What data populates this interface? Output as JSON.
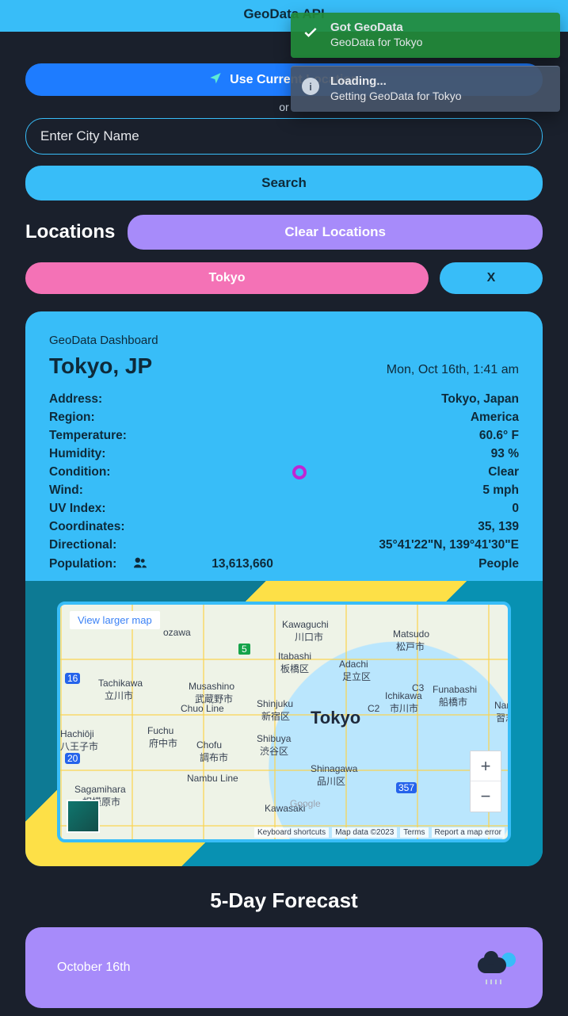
{
  "header": {
    "title": "GeoData API"
  },
  "controls": {
    "use_location_label": "Use Current Location",
    "or_label": "or",
    "city_placeholder": "Enter City Name",
    "search_label": "Search"
  },
  "locations": {
    "heading": "Locations",
    "clear_label": "Clear Locations",
    "items": [
      {
        "name": "Tokyo",
        "remove_label": "X"
      }
    ]
  },
  "toasts": [
    {
      "kind": "success",
      "title": "Got GeoData",
      "body": "GeoData for Tokyo"
    },
    {
      "kind": "info",
      "title": "Loading...",
      "body": "Getting GeoData for Tokyo"
    }
  ],
  "dashboard": {
    "label": "GeoData Dashboard",
    "city": "Tokyo, JP",
    "datetime": "Mon, Oct 16th, 1:41 am",
    "rows": {
      "address": {
        "k": "Address:",
        "v": "Tokyo, Japan"
      },
      "region": {
        "k": "Region:",
        "v": "America"
      },
      "temp": {
        "k": "Temperature:",
        "v": "60.6° F"
      },
      "humidity": {
        "k": "Humidity:",
        "v": "93 %"
      },
      "condition": {
        "k": "Condition:",
        "v": "Clear"
      },
      "wind": {
        "k": "Wind:",
        "v": "5 mph"
      },
      "uv": {
        "k": "UV Index:",
        "v": "0"
      },
      "coords": {
        "k": "Coordinates:",
        "v": "35, 139"
      },
      "direction": {
        "k": "Directional:",
        "v": "35°41'22\"N, 139°41'30\"E"
      },
      "population": {
        "k": "Population:",
        "num": "13,613,660",
        "unit": "People"
      }
    }
  },
  "map": {
    "view_larger": "View larger map",
    "places": {
      "kawaguchi": "Kawaguchi",
      "kawaguchi_jp": "川口市",
      "matsudo": "Matsudo",
      "matsudo_jp": "松戸市",
      "itabashi": "Itabashi",
      "itabashi_jp": "板橋区",
      "adachi": "Adachi",
      "adachi_jp": "足立区",
      "tachikawa": "Tachikawa",
      "tachikawa_jp": "立川市",
      "musashino": "Musashino",
      "musashino_jp": "武蔵野市",
      "shinjuku": "Shinjuku",
      "shinjuku_jp": "新宿区",
      "ichikawa": "Ichikawa",
      "ichikawa_jp": "市川市",
      "funabashi": "Funabashi",
      "funabashi_jp": "船橋市",
      "narashi": "Narashi",
      "narashi_jp": "習志野",
      "hachioji": "Hachiōji",
      "hachioji_jp": "八王子市",
      "fuchu": "Fuchu",
      "fuchu_jp": "府中市",
      "chofu": "Chofu",
      "chofu_jp": "調布市",
      "tokyo": "Tokyo",
      "shibuya": "Shibuya",
      "shibuya_jp": "渋谷区",
      "shinagawa": "Shinagawa",
      "shinagawa_jp": "品川区",
      "sagamihara": "Sagamihara",
      "sagamihara_jp": "相模原市",
      "kawasaki": "Kawasaki",
      "ozawa": "ozawa",
      "chuo": "Chuo Line",
      "nambu": "Nambu Line",
      "c2": "C2",
      "c3": "C3",
      "ks": "Keyboard shortcuts",
      "md": "Map data ©2023",
      "terms": "Terms",
      "report": "Report a map error",
      "hwy5": "5",
      "hwy16": "16",
      "hwy20": "20",
      "hwy357": "357",
      "tag_google": "Google"
    }
  },
  "forecast": {
    "heading": "5-Day Forecast",
    "days": [
      {
        "date": "October 16th"
      }
    ]
  }
}
